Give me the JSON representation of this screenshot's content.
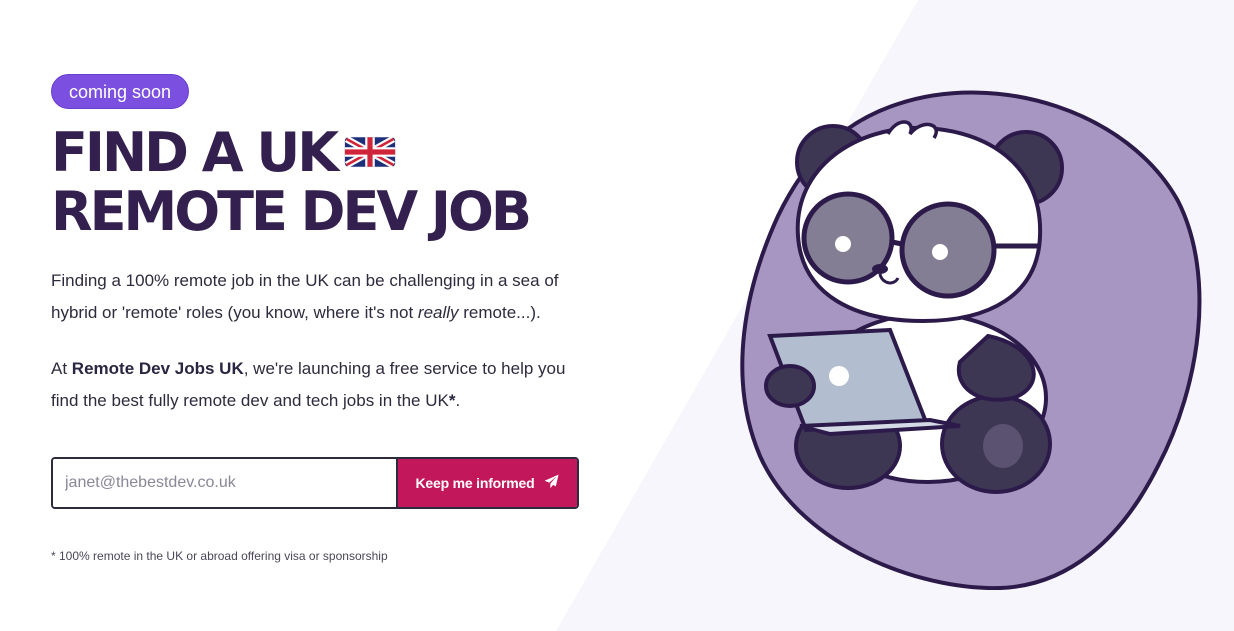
{
  "badge": "coming soon",
  "headline": {
    "line1": "FIND A UK",
    "line2": "REMOTE DEV JOB",
    "flag_icon": "uk-flag-icon"
  },
  "intro": {
    "part1": "Finding a 100% remote job in the UK can be challenging in a sea of hybrid or 'remote' roles (you know, where it's not ",
    "emphasis": "really",
    "part2": " remote...)."
  },
  "pitch": {
    "prefix": "At ",
    "brand": "Remote Dev Jobs UK",
    "suffix": ", we're launching a free service to help you find the best fully remote dev and tech jobs in the UK",
    "asterisk": "*",
    "end": "."
  },
  "signup": {
    "placeholder": "janet@thebestdev.co.uk",
    "value": "",
    "button_label": "Keep me informed",
    "button_icon": "paper-plane-icon"
  },
  "footnote": "* 100% remote in the UK or abroad offering visa or sponsorship",
  "colors": {
    "accent_purple": "#7b4fe0",
    "headline": "#33204f",
    "button": "#c2185b",
    "blob": "#a896c2"
  },
  "illustration_icon": "panda-with-laptop-illustration"
}
